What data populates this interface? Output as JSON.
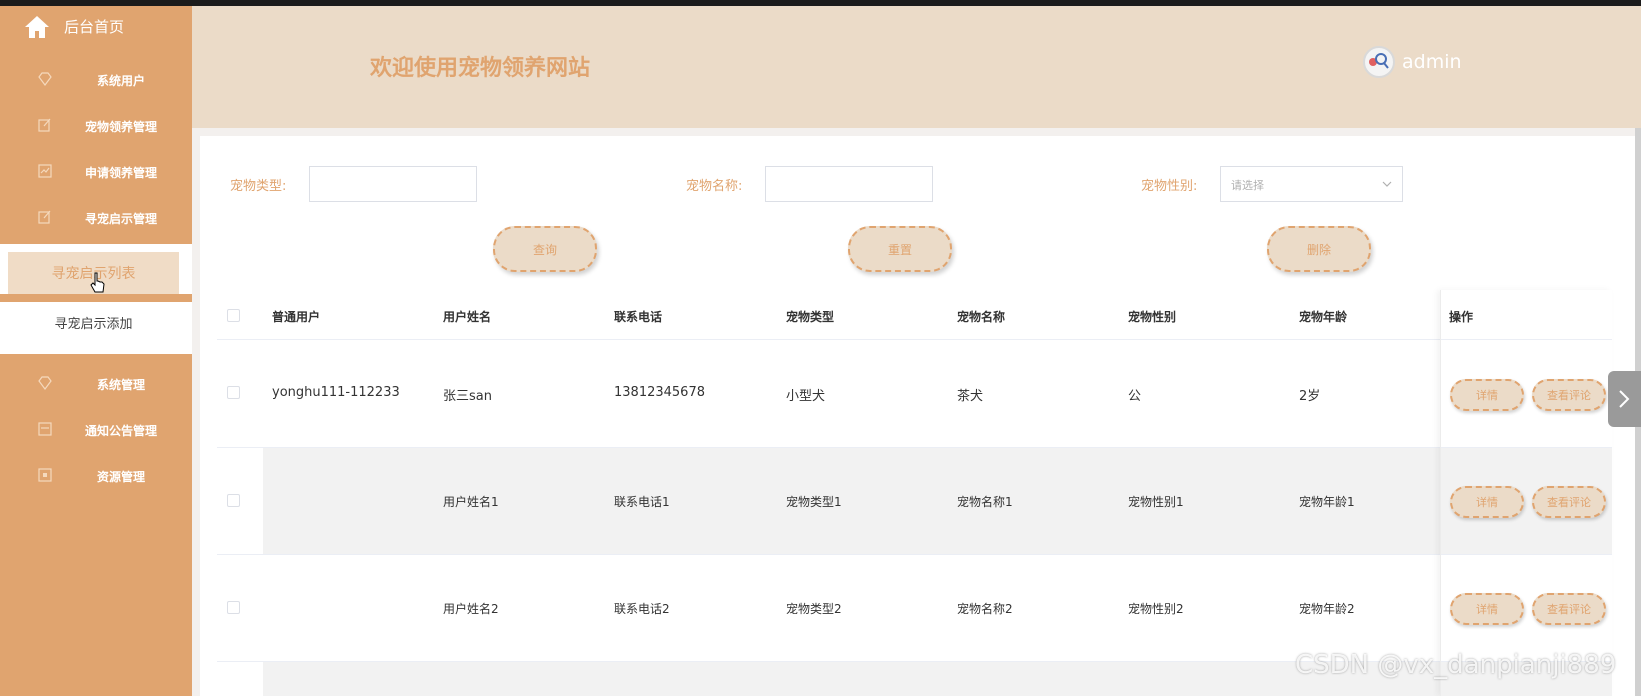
{
  "sidebar": {
    "home_label": "后台首页",
    "items": [
      {
        "label": "系统用户"
      },
      {
        "label": "宠物领养管理"
      },
      {
        "label": "申请领养管理"
      },
      {
        "label": "寻宠启示管理"
      },
      {
        "label": "系统管理"
      },
      {
        "label": "通知公告管理"
      },
      {
        "label": "资源管理"
      }
    ],
    "submenu": {
      "active_label": "寻宠启示列表",
      "add_label": "寻宠启示添加"
    }
  },
  "header": {
    "title": "欢迎使用宠物领养网站",
    "username": "admin"
  },
  "search": {
    "pet_type_label": "宠物类型:",
    "pet_name_label": "宠物名称:",
    "pet_gender_label": "宠物性别:",
    "gender_placeholder": "请选择",
    "query_button": "查询",
    "reset_button": "重置",
    "delete_button": "删除"
  },
  "table": {
    "columns": [
      "普通用户",
      "用户姓名",
      "联系电话",
      "宠物类型",
      "宠物名称",
      "宠物性别",
      "宠物年龄",
      "操作"
    ],
    "rows": [
      {
        "user": "yonghu111-112233",
        "name": "张三san",
        "phone": "13812345678",
        "type": "小型犬",
        "pet_name": "茶犬",
        "gender": "公",
        "age": "2岁"
      },
      {
        "user": "",
        "name": "用户姓名1",
        "phone": "联系电话1",
        "type": "宠物类型1",
        "pet_name": "宠物名称1",
        "gender": "宠物性别1",
        "age": "宠物年龄1"
      },
      {
        "user": "",
        "name": "用户姓名2",
        "phone": "联系电话2",
        "type": "宠物类型2",
        "pet_name": "宠物名称2",
        "gender": "宠物性别2",
        "age": "宠物年龄2"
      }
    ],
    "detail_button": "详情",
    "comment_button": "查看评论"
  },
  "watermark": "CSDN @vx_danpianji889",
  "colors": {
    "sidebar": "#e0a46f",
    "header": "#ebdbc8",
    "accent_text": "#e0a46f"
  }
}
